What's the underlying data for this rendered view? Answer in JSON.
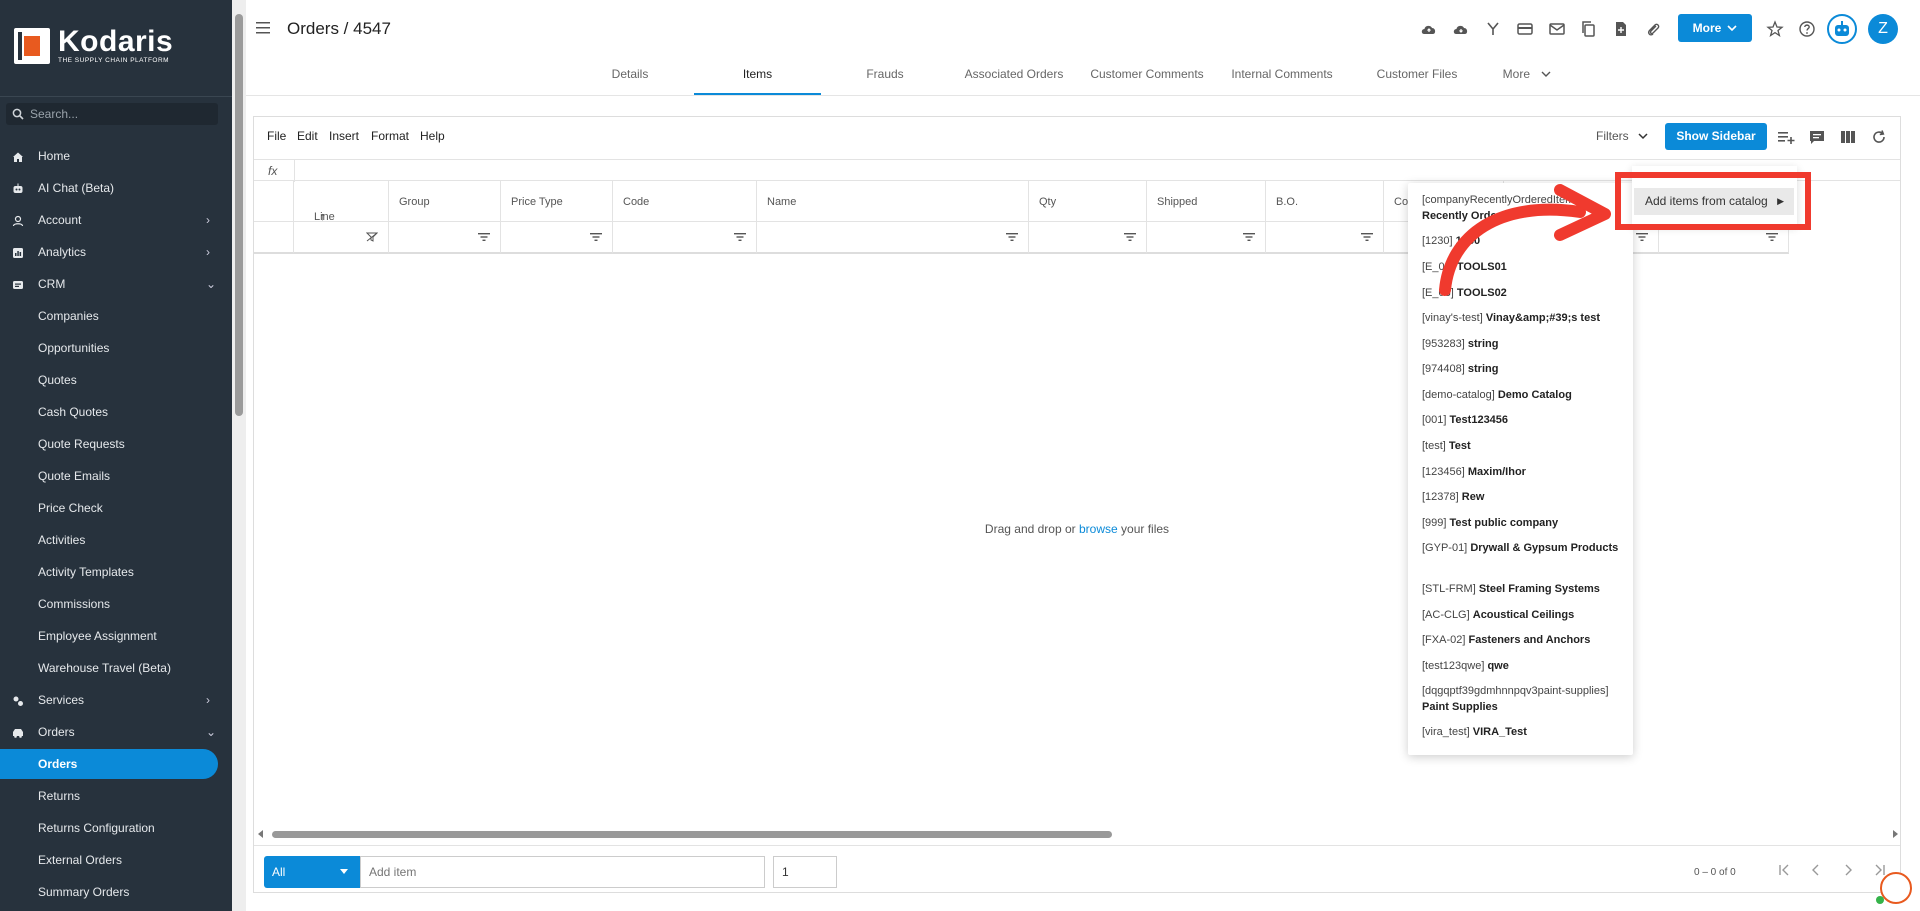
{
  "brand": {
    "name": "Kodaris",
    "tagline": "THE SUPPLY CHAIN PLATFORM"
  },
  "sidebar": {
    "search_placeholder": "Search...",
    "items": [
      {
        "label": "Home",
        "icon": "home-icon"
      },
      {
        "label": "AI Chat (Beta)",
        "icon": "robot-icon"
      },
      {
        "label": "Account",
        "icon": "person-icon",
        "chevron": "›"
      },
      {
        "label": "Analytics",
        "icon": "analytics-icon",
        "chevron": "›"
      },
      {
        "label": "CRM",
        "icon": "crm-icon",
        "chevron": "⌄"
      },
      {
        "label": "Companies"
      },
      {
        "label": "Opportunities"
      },
      {
        "label": "Quotes"
      },
      {
        "label": "Cash Quotes"
      },
      {
        "label": "Quote Requests"
      },
      {
        "label": "Quote Emails"
      },
      {
        "label": "Price Check"
      },
      {
        "label": "Activities"
      },
      {
        "label": "Activity Templates"
      },
      {
        "label": "Commissions"
      },
      {
        "label": "Employee Assignment"
      },
      {
        "label": "Warehouse Travel (Beta)"
      },
      {
        "label": "Services",
        "icon": "services-icon",
        "chevron": "›"
      },
      {
        "label": "Orders",
        "icon": "orders-icon",
        "chevron": "⌄"
      },
      {
        "label": "Orders"
      },
      {
        "label": "Returns"
      },
      {
        "label": "Returns Configuration"
      },
      {
        "label": "External Orders"
      },
      {
        "label": "Summary Orders"
      }
    ]
  },
  "header": {
    "title": "Orders / 4547",
    "more_label": "More",
    "avatar_initial": "Z"
  },
  "tabs": [
    "Details",
    "Items",
    "Frauds",
    "Associated Orders",
    "Customer Comments",
    "Internal Comments",
    "Customer Files",
    "More"
  ],
  "grid": {
    "menu": [
      "File",
      "Edit",
      "Insert",
      "Format",
      "Help"
    ],
    "filters_label": "Filters",
    "show_sidebar_label": "Show Sidebar",
    "fx_label": "fx",
    "columns": [
      "Line",
      "Group",
      "Price Type",
      "Code",
      "Name",
      "Qty",
      "Shipped",
      "B.O.",
      "Co"
    ],
    "sort_arrow": "↑",
    "empty_text_before": "Drag and drop or",
    "empty_link": "browse",
    "empty_text_after": "your files"
  },
  "footer": {
    "scope_value": "All",
    "add_item_placeholder": "Add item",
    "qty_value": "1",
    "pager_text": "0 – 0 of 0"
  },
  "catalog_menu": {
    "items": [
      {
        "code": "[companyRecentlyOrderedItems]",
        "name": "Recently Ordered"
      },
      {
        "code": "[1230]",
        "name": "1230"
      },
      {
        "code": "[E_02]",
        "name": "TOOLS01"
      },
      {
        "code": "[E_03]",
        "name": "TOOLS02"
      },
      {
        "code": "[vinay's-test]",
        "name": "Vinay&amp;#39;s test"
      },
      {
        "code": "[953283]",
        "name": "string"
      },
      {
        "code": "[974408]",
        "name": "string"
      },
      {
        "code": "[demo-catalog]",
        "name": "Demo Catalog"
      },
      {
        "code": "[001]",
        "name": "Test123456"
      },
      {
        "code": "[test]",
        "name": "Test"
      },
      {
        "code": "[123456]",
        "name": "Maxim/Ihor"
      },
      {
        "code": "[12378]",
        "name": "Rew"
      },
      {
        "code": "[999]",
        "name": "Test public company"
      },
      {
        "code": "[GYP-01]",
        "name": "Drywall & Gypsum Products"
      },
      {
        "code": "[STL-FRM]",
        "name": "Steel Framing Systems"
      },
      {
        "code": "[AC-CLG]",
        "name": "Acoustical Ceilings"
      },
      {
        "code": "[FXA-02]",
        "name": "Fasteners and Anchors"
      },
      {
        "code": "[test123qwe]",
        "name": "qwe"
      },
      {
        "code": "[dqgqptf39gdmhnnpqv3paint-supplies]",
        "name": "Paint Supplies"
      },
      {
        "code": "[vira_test]",
        "name": "VIRA_Test"
      }
    ],
    "submenu_label": "Add items from catalog"
  },
  "colors": {
    "accent": "#0b8ad8",
    "sidebar": "#27323d",
    "highlight": "#f03a2e"
  }
}
